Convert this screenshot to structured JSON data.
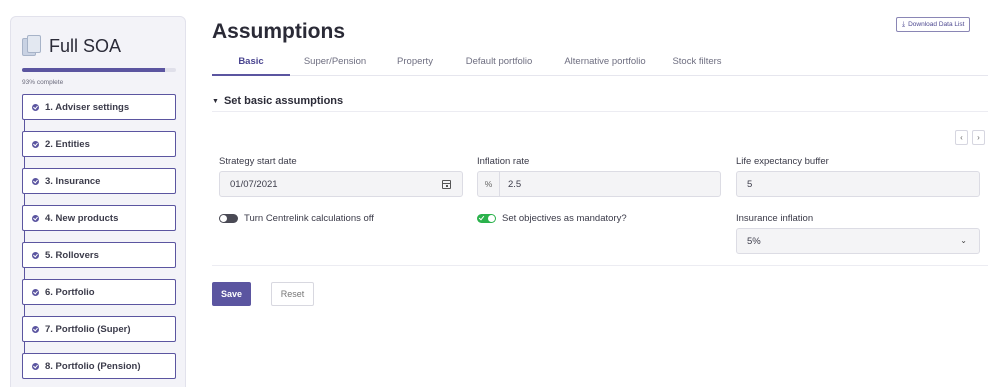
{
  "sidebar": {
    "title": "Full SOA",
    "progress_value": 0.93,
    "progress_label": "93% complete",
    "steps": [
      {
        "label": "1. Adviser settings"
      },
      {
        "label": "2. Entities"
      },
      {
        "label": "3. Insurance"
      },
      {
        "label": "4. New products"
      },
      {
        "label": "5. Rollovers"
      },
      {
        "label": "6. Portfolio"
      },
      {
        "label": "7. Portfolio (Super)"
      },
      {
        "label": "8. Portfolio (Pension)"
      }
    ]
  },
  "header": {
    "title": "Assumptions",
    "download_label": "Download Data List"
  },
  "tabs": [
    {
      "label": "Basic",
      "active": true
    },
    {
      "label": "Super/Pension",
      "active": false
    },
    {
      "label": "Property",
      "active": false
    },
    {
      "label": "Default portfolio",
      "active": false
    },
    {
      "label": "Alternative portfolio",
      "active": false
    },
    {
      "label": "Stock filters",
      "active": false
    }
  ],
  "section": {
    "title": "Set basic assumptions"
  },
  "pager": {
    "prev": "‹",
    "next": "›"
  },
  "fields": {
    "strategy_start": {
      "label": "Strategy start date",
      "value": "01/07/2021"
    },
    "inflation": {
      "label": "Inflation rate",
      "prefix": "%",
      "value": "2.5"
    },
    "life_buffer": {
      "label": "Life expectancy buffer",
      "value": "5"
    },
    "insurance_inflation": {
      "label": "Insurance inflation",
      "value": "5%"
    }
  },
  "toggles": {
    "centrelink": {
      "label": "Turn Centrelink calculations off",
      "on": false
    },
    "objectives": {
      "label": "Set objectives as mandatory?",
      "on": true
    }
  },
  "actions": {
    "save": "Save",
    "reset": "Reset"
  },
  "colors": {
    "accent": "#5b55a0",
    "toggle_on": "#2bb24c",
    "toggle_off": "#4a4a55"
  }
}
